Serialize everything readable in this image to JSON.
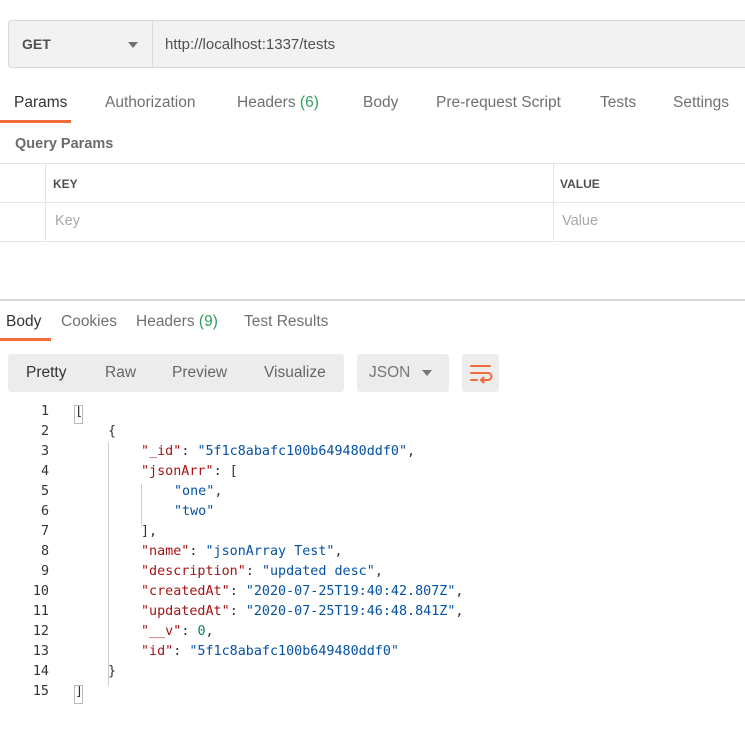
{
  "request": {
    "method": "GET",
    "url": "http://localhost:1337/tests"
  },
  "request_tabs": {
    "params": "Params",
    "authorization": "Authorization",
    "headers": "Headers",
    "headers_count": "(6)",
    "body": "Body",
    "prerequest": "Pre-request Script",
    "tests": "Tests",
    "settings": "Settings"
  },
  "query_params": {
    "title": "Query Params",
    "key_header": "KEY",
    "value_header": "VALUE",
    "key_placeholder": "Key",
    "value_placeholder": "Value"
  },
  "response_tabs": {
    "body": "Body",
    "cookies": "Cookies",
    "headers": "Headers",
    "headers_count": "(9)",
    "test_results": "Test Results"
  },
  "view_modes": {
    "pretty": "Pretty",
    "raw": "Raw",
    "preview": "Preview",
    "visualize": "Visualize",
    "format": "JSON"
  },
  "icons": {
    "wrap": "wrap-lines-icon",
    "method_dropdown": "chevron-down-icon",
    "format_dropdown": "chevron-down-icon"
  },
  "colors": {
    "accent": "#f26b3a",
    "count": "#2e9f5c",
    "json_key": "#a31515",
    "json_string": "#0451a5",
    "json_number": "#098658"
  },
  "code_lines": [
    {
      "n": "1",
      "text": "["
    },
    {
      "n": "2",
      "text": "{"
    },
    {
      "n": "3",
      "key": "\"_id\"",
      "val": "\"5f1c8abafc100b649480ddf0\"",
      "tail": ","
    },
    {
      "n": "4",
      "key": "\"jsonArr\"",
      "tail": ": ["
    },
    {
      "n": "5",
      "val": "\"one\"",
      "tail": ","
    },
    {
      "n": "6",
      "val": "\"two\"",
      "tail": ""
    },
    {
      "n": "7",
      "text": "],"
    },
    {
      "n": "8",
      "key": "\"name\"",
      "val": "\"jsonArray Test\"",
      "tail": ","
    },
    {
      "n": "9",
      "key": "\"description\"",
      "val": "\"updated desc\"",
      "tail": ","
    },
    {
      "n": "10",
      "key": "\"createdAt\"",
      "val": "\"2020-07-25T19:40:42.807Z\"",
      "tail": ","
    },
    {
      "n": "11",
      "key": "\"updatedAt\"",
      "val": "\"2020-07-25T19:46:48.841Z\"",
      "tail": ","
    },
    {
      "n": "12",
      "key": "\"__v\"",
      "num": "0",
      "tail": ","
    },
    {
      "n": "13",
      "key": "\"id\"",
      "val": "\"5f1c8abafc100b649480ddf0\"",
      "tail": ""
    },
    {
      "n": "14",
      "text": "}"
    },
    {
      "n": "15",
      "text": "]"
    }
  ]
}
